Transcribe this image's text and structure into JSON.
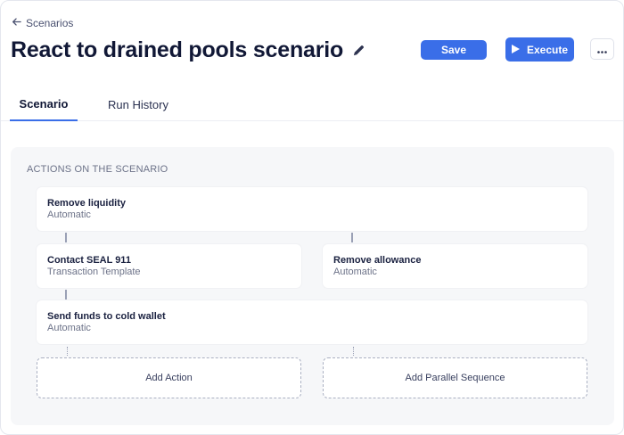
{
  "header": {
    "back_label": "Scenarios",
    "title": "React to drained pools scenario",
    "save_label": "Save",
    "execute_label": "Execute"
  },
  "tabs": [
    {
      "label": "Scenario",
      "active": true
    },
    {
      "label": "Run History",
      "active": false
    }
  ],
  "panel": {
    "heading": "ACTIONS ON THE SCENARIO",
    "actions": [
      {
        "title": "Remove liquidity",
        "type": "Automatic"
      },
      {
        "title": "Contact SEAL 911",
        "type": "Transaction Template"
      },
      {
        "title": "Remove allowance",
        "type": "Automatic"
      },
      {
        "title": "Send funds to cold wallet",
        "type": "Automatic"
      }
    ],
    "add_action_label": "Add Action",
    "add_parallel_label": "Add Parallel Sequence"
  },
  "colors": {
    "accent": "#3a6ee8",
    "title_text": "#111836",
    "muted_text": "#6c7288",
    "panel_bg": "#f6f7f9"
  },
  "icons": {
    "back": "arrow-left-icon",
    "edit": "pencil-icon",
    "execute": "play-icon",
    "more": "ellipsis-icon"
  }
}
